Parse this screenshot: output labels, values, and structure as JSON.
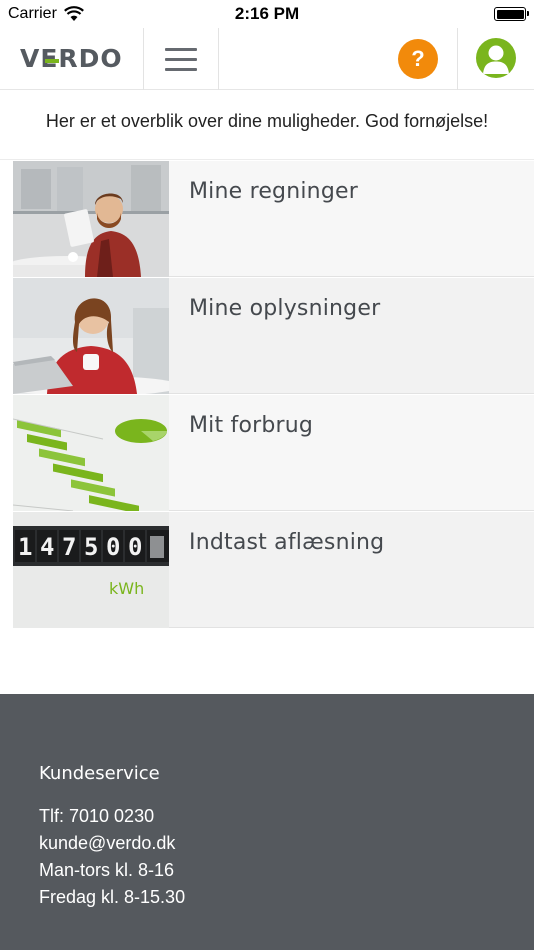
{
  "status_bar": {
    "carrier": "Carrier",
    "time": "2:16 PM"
  },
  "header": {
    "logo_text": "VERDO",
    "help_label": "?",
    "brand_green": "#7ab51d",
    "help_orange": "#f28a0b"
  },
  "intro": {
    "text": "Her er et overblik over dine muligheder. God fornøjelse!"
  },
  "menu": {
    "items": [
      {
        "label": "Mine regninger",
        "icon": "man-with-tablet-photo"
      },
      {
        "label": "Mine oplysninger",
        "icon": "woman-with-laptop-photo"
      },
      {
        "label": "Mit forbrug",
        "icon": "green-bar-chart-photo"
      },
      {
        "label": "Indtast aflæsning",
        "icon": "kwh-meter-photo"
      }
    ]
  },
  "footer": {
    "title": "Kundeservice",
    "phone": "Tlf: 7010 0230",
    "email": "kunde@verdo.dk",
    "hours_weekdays": "Man-tors kl. 8-16",
    "hours_friday": "Fredag kl. 8-15.30",
    "background": "#55595e"
  },
  "meter_digits": "147500"
}
